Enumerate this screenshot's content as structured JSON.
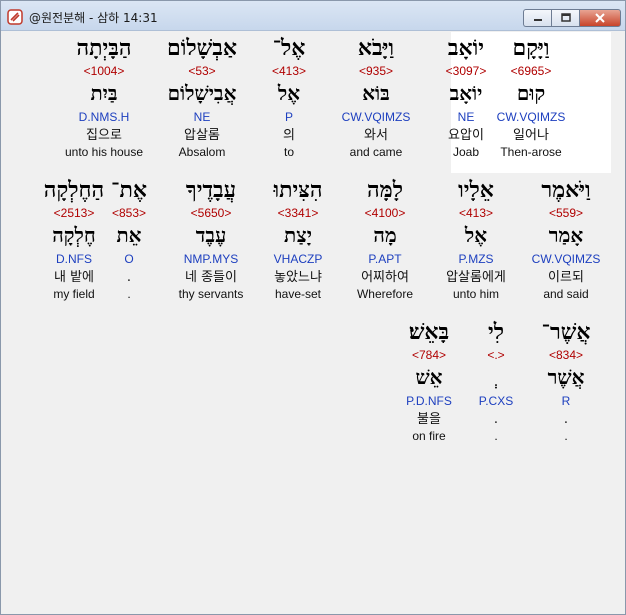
{
  "window": {
    "title": "@원전분해 - 삼하 14:31",
    "buttons": {
      "minimize": "minimize",
      "maximize": "maximize",
      "close": "close"
    }
  },
  "rows": [
    {
      "words": [
        {
          "hebrew": "וַיָּקָם",
          "strong": "<6965>",
          "lemma": "קוּם",
          "parse": "CW.VQIMZS",
          "korean": "일어나",
          "english": "Then-arose"
        },
        {
          "hebrew": "יוֹאָב",
          "strong": "<3097>",
          "lemma": "יוֹאָב",
          "parse": "NE",
          "korean": "요압이",
          "english": "Joab"
        },
        {
          "hebrew": "וַיָּבֹא",
          "strong": "<935>",
          "lemma": "בּוֹא",
          "parse": "CW.VQIMZS",
          "korean": "와서",
          "english": "and came"
        },
        {
          "hebrew": "אֶל־",
          "strong": "<413>",
          "lemma": "אֶל",
          "parse": "P",
          "korean": "의",
          "english": "to"
        },
        {
          "hebrew": "אַבְשָׁלוֹם",
          "strong": "<53>",
          "lemma": "אֲבִישָׁלוֹם",
          "parse": "NE",
          "korean": "압살롬",
          "english": "Absalom"
        },
        {
          "hebrew": "הַבָּיְתָה",
          "strong": "<1004>",
          "lemma": "בַּיִת",
          "parse": "D.NMS.H",
          "korean": "집으로",
          "english": "unto his house"
        }
      ]
    },
    {
      "words": [
        {
          "hebrew": "וַיֹּאמֶר",
          "strong": "<559>",
          "lemma": "אָמַר",
          "parse": "CW.VQIMZS",
          "korean": "이르되",
          "english": "and said"
        },
        {
          "hebrew": "אֵלָיו",
          "strong": "<413>",
          "lemma": "אֶל",
          "parse": "P.MZS",
          "korean": "압살롬에게",
          "english": "unto him"
        },
        {
          "hebrew": "לָמָּה",
          "strong": "<4100>",
          "lemma": "מָה",
          "parse": "P.APT",
          "korean": "어찌하여",
          "english": "Wherefore"
        },
        {
          "hebrew": "הִצִּיתוּ",
          "strong": "<3341>",
          "lemma": "יָצַת",
          "parse": "VHACZP",
          "korean": "놓았느냐",
          "english": "have-set"
        },
        {
          "hebrew": "עֲבָדֶיךָ",
          "strong": "<5650>",
          "lemma": "עֶבֶד",
          "parse": "NMP.MYS",
          "korean": "네 종들이",
          "english": "thy servants"
        },
        {
          "hebrew": "אֶת־",
          "strong": "<853>",
          "lemma": "אֵת",
          "parse": "O",
          "korean": ".",
          "english": "."
        },
        {
          "hebrew": "הַחֶלְקָה",
          "strong": "<2513>",
          "lemma": "חֶלְקָה",
          "parse": "D.NFS",
          "korean": "내 밭에",
          "english": "my field"
        }
      ]
    },
    {
      "words": [
        {
          "hebrew": "אֲשֶׁר־",
          "strong": "<834>",
          "lemma": "אֲשֶׁר",
          "parse": "R",
          "korean": ".",
          "english": "."
        },
        {
          "hebrew": "לִי",
          "strong": "<.>",
          "lemma": "ְ",
          "parse": "P.CXS",
          "korean": ".",
          "english": "."
        },
        {
          "hebrew": "בָּאֵשׁ׃",
          "strong": "<784>",
          "lemma": "אֵשׁ",
          "parse": "P.D.NFS",
          "korean": "불을",
          "english": "on fire"
        }
      ]
    }
  ]
}
